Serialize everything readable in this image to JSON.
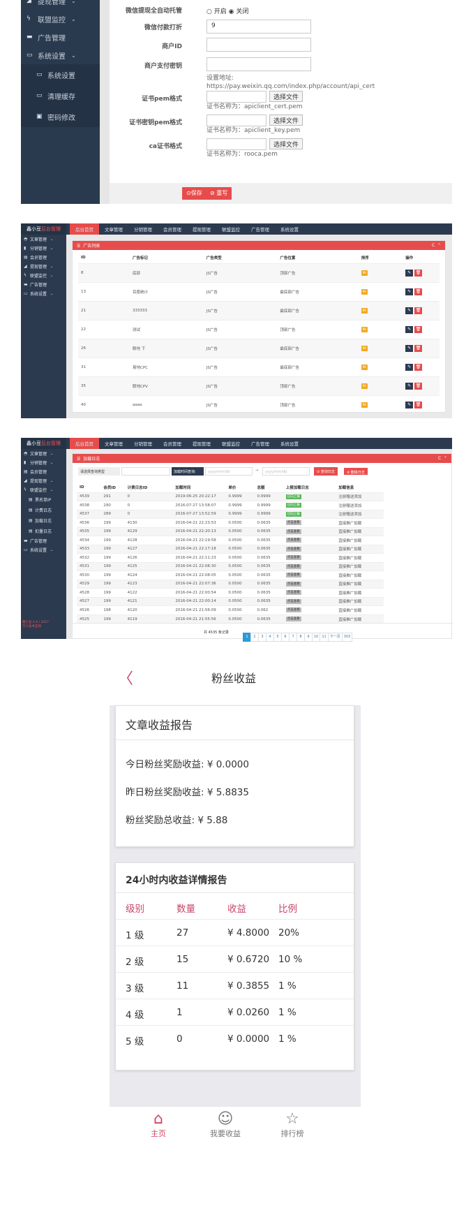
{
  "panel1": {
    "sidebar": [
      {
        "icon": "chart-icon",
        "label": "提现管理",
        "chevron": true
      },
      {
        "icon": "bolt-icon",
        "label": "联盟监控",
        "chevron": true
      },
      {
        "icon": "ad-icon",
        "label": "广告管理",
        "chevron": false
      },
      {
        "icon": "monitor-icon",
        "label": "系统设置",
        "chevron": true
      },
      {
        "icon": "monitor-icon",
        "label": "系统设置",
        "sub": true
      },
      {
        "icon": "monitor-icon",
        "label": "清理缓存",
        "sub": true
      },
      {
        "icon": "image-icon",
        "label": "密码修改",
        "sub": true
      }
    ],
    "form": {
      "wx_auto_label": "微信提现全自动托管",
      "wx_auto_on": "开启",
      "wx_auto_off": "关闭",
      "discount_label": "微信付款打折",
      "discount_value": "9",
      "merchant_label": "商户ID",
      "merchant_value": "",
      "key_label": "商户支付密钥",
      "key_value": "",
      "key_help1": "设置地址:",
      "key_help2": "https://pay.weixin.qq.com/index.php/account/api_cert",
      "cert_label": "证书pem格式",
      "cert_btn": "选择文件",
      "cert_help": "证书名称为：apiclient_cert.pem",
      "certkey_label": "证书密钥pem格式",
      "certkey_btn": "选择文件",
      "certkey_help": "证书名称为：apiclient_key.pem",
      "ca_label": "ca证书格式",
      "ca_btn": "选择文件",
      "ca_help": "证书名称为：rooca.pem",
      "save": "⊙保存",
      "reset": "⊘ 重写"
    }
  },
  "topnav": {
    "logo_white": "鑫小豆",
    "logo_red": "后台管理",
    "items": [
      "后台首页",
      "文章管理",
      "分销管理",
      "会员管理",
      "提现管理",
      "联盟监控",
      "广告管理",
      "系统设置"
    ]
  },
  "panel2": {
    "sidebar": [
      {
        "icon": "car-icon",
        "label": "文章管理"
      },
      {
        "icon": "file-icon",
        "label": "分销管理"
      },
      {
        "icon": "card-icon",
        "label": "会员管理"
      },
      {
        "icon": "chart-icon",
        "label": "提现管理"
      },
      {
        "icon": "bolt-icon",
        "label": "联盟监控"
      },
      {
        "icon": "ad-icon",
        "label": "广告管理"
      },
      {
        "icon": "monitor-icon",
        "label": "系统设置"
      }
    ],
    "card_title": "广告列表",
    "headers": [
      "ID",
      "广告标记",
      "广告类型",
      "广告位置",
      "排序",
      "操作"
    ],
    "rows": [
      [
        "8",
        "底部",
        "JS广告",
        "顶部广告",
        "99"
      ],
      [
        "13",
        "百度统计",
        "JS广告",
        "最底部广告",
        "99"
      ],
      [
        "21",
        "333333",
        "JS广告",
        "最底部广告",
        "99"
      ],
      [
        "22",
        "测试",
        "JS广告",
        "顶部广告",
        "99"
      ],
      [
        "26",
        "联地 下",
        "JS广告",
        "最底部广告",
        "99"
      ],
      [
        "31",
        "易地CPC",
        "JS广告",
        "最底部广告",
        "99"
      ],
      [
        "35",
        "联地CPV",
        "JS广告",
        "顶部广告",
        "99"
      ],
      [
        "40",
        "aaaa",
        "JS广告",
        "顶部广告",
        "99"
      ]
    ]
  },
  "panel3": {
    "sidebar": [
      {
        "icon": "car-icon",
        "label": "文章管理"
      },
      {
        "icon": "file-icon",
        "label": "分销管理"
      },
      {
        "icon": "card-icon",
        "label": "会员管理"
      },
      {
        "icon": "chart-icon",
        "label": "提现管理"
      },
      {
        "icon": "bolt-icon",
        "label": "联盟监控"
      },
      {
        "icon": "list-icon",
        "label": "黑名单IP",
        "sub": true
      },
      {
        "icon": "list-icon",
        "label": "计费日志",
        "sub": true
      },
      {
        "icon": "list-icon",
        "label": "加载日志",
        "sub": true
      },
      {
        "icon": "list-icon",
        "label": "扣量日志",
        "sub": true
      },
      {
        "icon": "ad-icon",
        "label": "广告管理"
      },
      {
        "icon": "monitor-icon",
        "label": "系统设置"
      }
    ],
    "footer_note1": "鑫小豆 2.0 / 2017",
    "footer_note2": "万人技术支持",
    "card_title": "加载日志",
    "filter_select": "请选择查询类型",
    "filter_time": "加载时间查询:",
    "date_from": "yyyy/mm/dd",
    "arrow": "→",
    "date_to": "yyyy/mm/dd",
    "btn_query": "⊙ 查询日志",
    "btn_delete": "⊘ 删除日志",
    "headers": [
      "ID",
      "会员ID",
      "计费日志ID",
      "加载时间",
      "单价",
      "总额",
      "上报加载日志",
      "加载信息"
    ],
    "rows": [
      [
        "4539",
        "291",
        "0",
        "2019-06-25 20:22:17",
        "0.9999",
        "0.9999",
        "g",
        "注册赠送添加"
      ],
      [
        "4538",
        "290",
        "0",
        "2016-07-27 13:58:07",
        "0.9999",
        "0.9999",
        "g",
        "注册赠送添加"
      ],
      [
        "4537",
        "289",
        "0",
        "2016-07-27 13:52:59",
        "0.9999",
        "0.9999",
        "g",
        "注册赠送添加"
      ],
      [
        "4536",
        "199",
        "4130",
        "2016-04-21 22:23:53",
        "0.0500",
        "0.0635",
        "r",
        "直接推广加载"
      ],
      [
        "4535",
        "199",
        "4129",
        "2016-04-21 22:20:13",
        "0.0500",
        "0.0635",
        "r",
        "直接推广加载"
      ],
      [
        "4534",
        "199",
        "4128",
        "2016-04-21 22:19:58",
        "0.0500",
        "0.0635",
        "r",
        "直接推广加载"
      ],
      [
        "4533",
        "199",
        "4127",
        "2016-04-21 22:17:18",
        "0.0500",
        "0.0635",
        "r",
        "直接推广加载"
      ],
      [
        "4532",
        "199",
        "4126",
        "2016-04-21 22:11:23",
        "0.0500",
        "0.0635",
        "r",
        "直接推广加载"
      ],
      [
        "4531",
        "199",
        "4125",
        "2016-04-21 22:08:30",
        "0.0500",
        "0.0635",
        "r",
        "直接推广加载"
      ],
      [
        "4530",
        "199",
        "4124",
        "2016-04-21 22:08:05",
        "0.0500",
        "0.0635",
        "r",
        "直接推广加载"
      ],
      [
        "4529",
        "199",
        "4123",
        "2016-04-21 22:07:36",
        "0.0500",
        "0.0635",
        "r",
        "直接推广加载"
      ],
      [
        "4528",
        "199",
        "4122",
        "2016-04-21 22:00:54",
        "0.0500",
        "0.0635",
        "r",
        "直接推广加载"
      ],
      [
        "4527",
        "199",
        "4121",
        "2016-04-21 22:00:14",
        "0.0500",
        "0.0635",
        "r",
        "直接推广加载"
      ],
      [
        "4526",
        "198",
        "4120",
        "2016-04-21 21:56:09",
        "0.0500",
        "0.062",
        "r",
        "直接推广加载"
      ],
      [
        "4525",
        "199",
        "4119",
        "2016-04-21 21:55:56",
        "0.0500",
        "0.0635",
        "r",
        "直接推广加载"
      ]
    ],
    "badge_green": "已向上报",
    "badge_gray": "点击查看",
    "total": "共 4535 条记录",
    "pages": [
      "1",
      "2",
      "3",
      "4",
      "5",
      "6",
      "7",
      "8",
      "9",
      "10",
      "11",
      "下一页",
      "303"
    ]
  },
  "mobile": {
    "title": "粉丝收益",
    "back": "〈",
    "report_title": "文章收益报告",
    "today": "今日粉丝奖励收益: ¥ 0.0000",
    "yesterday": "昨日粉丝奖励收益: ¥ 5.8835",
    "total": "粉丝奖励总收益: ¥ 5.88",
    "detail_title": "24小时内收益详情报告",
    "headers": [
      "级别",
      "数量",
      "收益",
      "比例"
    ],
    "rows": [
      [
        "1 级",
        "27",
        "¥ 4.8000",
        "20%"
      ],
      [
        "2 级",
        "15",
        "¥ 0.6720",
        "10 %"
      ],
      [
        "3 级",
        "11",
        "¥ 0.3855",
        "1 %"
      ],
      [
        "4 级",
        "1",
        "¥ 0.0260",
        "1 %"
      ],
      [
        "5 级",
        "0",
        "¥ 0.0000",
        "1 %"
      ]
    ],
    "tabs": [
      {
        "icon": "home-icon",
        "label": "主页",
        "active": true
      },
      {
        "icon": "user-icon",
        "label": "我要收益",
        "active": false
      },
      {
        "icon": "star-icon",
        "label": "排行榜",
        "active": false
      }
    ]
  },
  "colors": {
    "accent": "#e74c4c",
    "sidebar": "#2c3a4f",
    "mobile_accent": "#d0455f"
  }
}
